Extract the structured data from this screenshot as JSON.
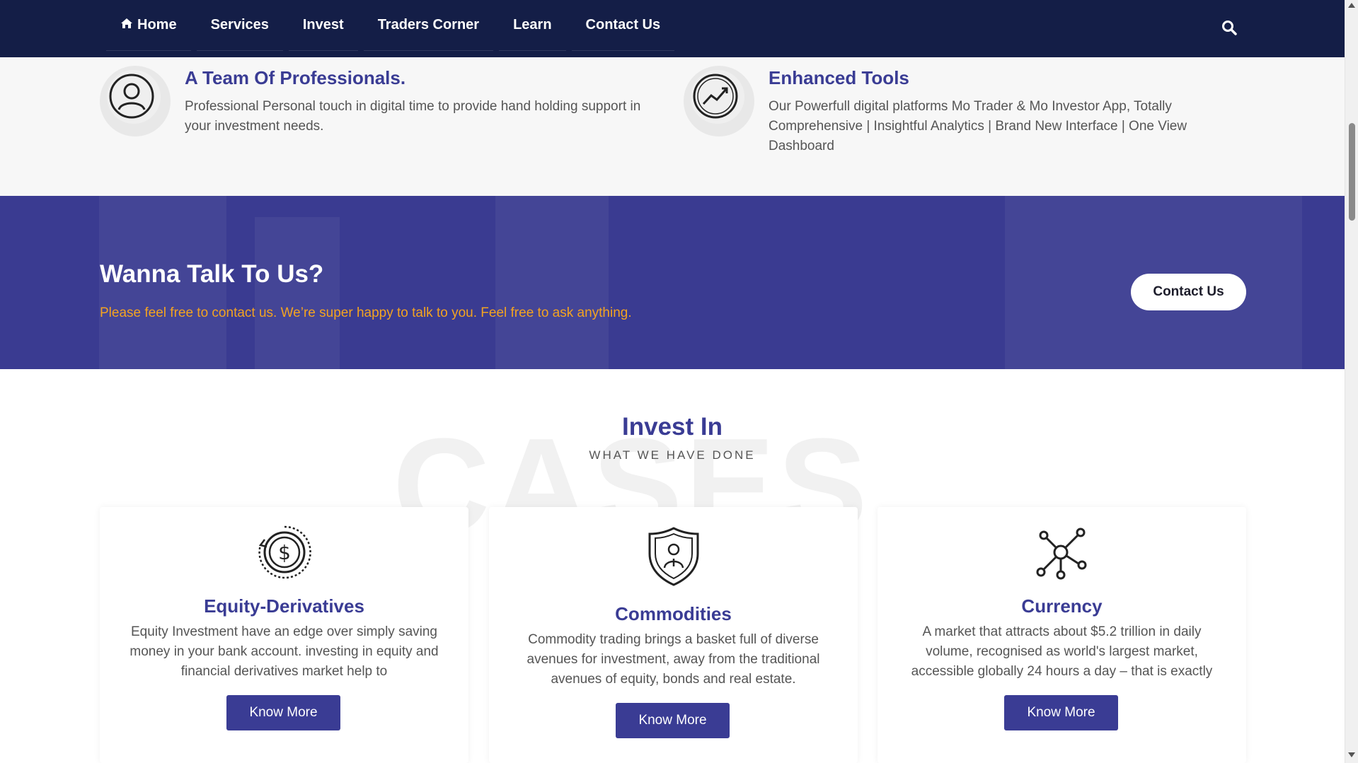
{
  "nav": {
    "items": [
      {
        "label": "Home",
        "icon": "home-icon"
      },
      {
        "label": "Services"
      },
      {
        "label": "Invest"
      },
      {
        "label": "Traders Corner"
      },
      {
        "label": "Learn"
      },
      {
        "label": "Contact Us"
      }
    ],
    "search_icon": "search-icon"
  },
  "features": [
    {
      "title": "A Team Of Professionals.",
      "description": "Professional Personal touch in digital time to provide hand holding support in your investment needs.",
      "icon": "user-icon"
    },
    {
      "title": "Enhanced Tools",
      "description": "Our Powerfull digital platforms Mo Trader & Mo Investor App, Totally Comprehensive | Insightful Analytics | Brand New Interface | One View Dashboard",
      "icon": "trend-chart-icon"
    }
  ],
  "cta": {
    "title": "Wanna Talk To Us?",
    "text": "Please feel free to contact us. We’re super happy to talk to you. Feel free to ask anything.",
    "button": "Contact Us"
  },
  "invest": {
    "background_word": "CASES",
    "title": "Invest In",
    "subtitle": "WHAT WE HAVE DONE",
    "cards": [
      {
        "title": "Equity-Derivatives",
        "description": "Equity Investment have an edge over simply saving money in your bank account. investing in equity and financial derivatives market help to",
        "button": "Know More",
        "icon": "dollar-coin-icon"
      },
      {
        "title": "Commodities",
        "description": "Commodity trading brings a basket full of diverse avenues for investment, away from the traditional avenues of equity, bonds and real estate.",
        "button": "Know More",
        "icon": "shield-person-icon"
      },
      {
        "title": "Currency",
        "description": "A market that attracts about $5.2 trillion in daily volume, recognised as world's largest market, accessible globally 24 hours a day – that is exactly",
        "button": "Know More",
        "icon": "network-nodes-icon"
      }
    ]
  },
  "colors": {
    "navbar": "#141e47",
    "brand": "#3a3c94",
    "cta_text": "#f3a321"
  }
}
